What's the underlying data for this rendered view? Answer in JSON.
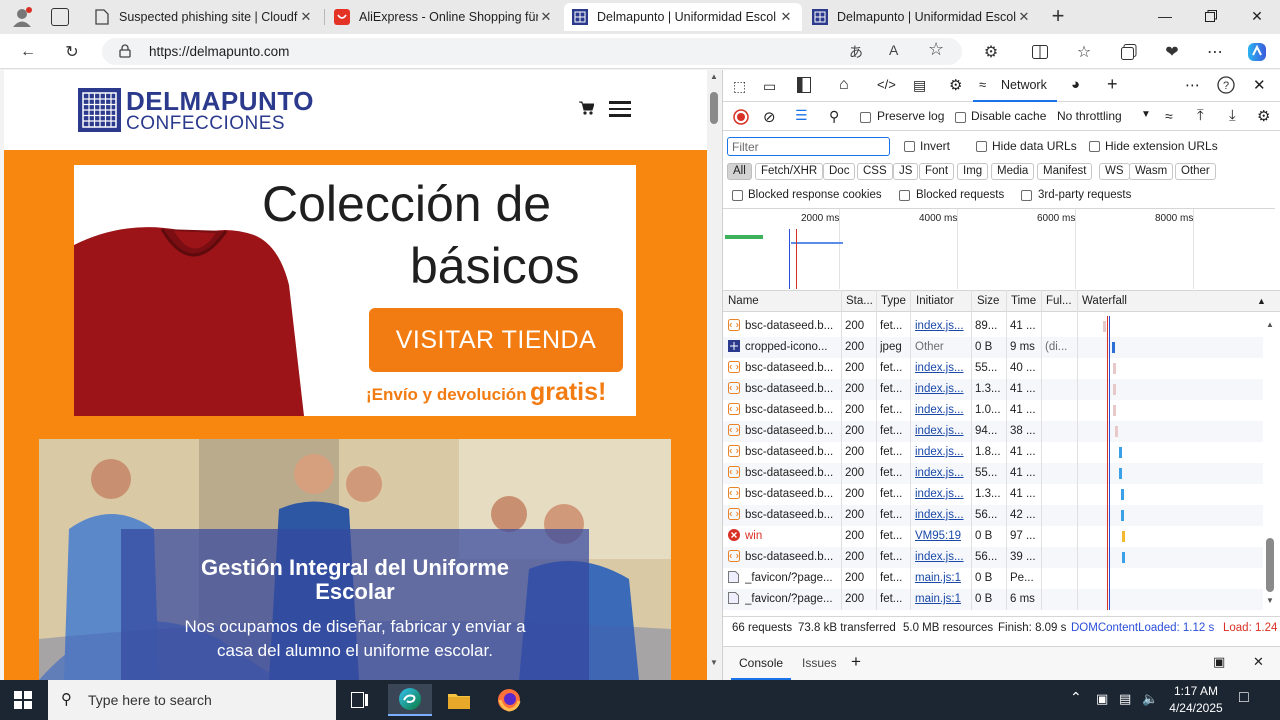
{
  "browser": {
    "tabs": [
      {
        "title": "Suspected phishing site | Cloudfl",
        "icon": "page-icon"
      },
      {
        "title": "AliExpress - Online Shopping für",
        "icon": "aliexpress-icon"
      },
      {
        "title": "Delmapunto | Uniformidad Escol",
        "icon": "site-icon",
        "active": true
      },
      {
        "title": "Delmapunto | Uniformidad Escol",
        "icon": "site-icon"
      }
    ],
    "new_tab_symbol": "+",
    "close_symbol": "✕",
    "url": "https://delmapunto.com"
  },
  "site": {
    "logo_title": "DELMAPUNTO",
    "logo_subtitle": "CONFECCIONES",
    "banner_line1": "Colección de",
    "banner_line2": "básicos",
    "banner_button": "VISITAR TIENDA",
    "banner_tagline_prefix": "¡Envío y devolución",
    "banner_tagline_emphasis": "gratis!",
    "hero_title_line1": "Gestión Integral del Uniforme",
    "hero_title_line2": "Escolar",
    "hero_text_line1": "Nos ocupamos de diseñar, fabricar y enviar a",
    "hero_text_line2": "casa del alumno el uniforme escolar.",
    "colors": {
      "orange": "#f7870f",
      "navy": "#2b3a8c",
      "sweater": "#9c1418"
    }
  },
  "devtools": {
    "active_panel": "Network",
    "preserve_log": "Preserve log",
    "disable_cache": "Disable cache",
    "throttling": "No throttling",
    "filter_placeholder": "Filter",
    "invert": "Invert",
    "hide_data_urls": "Hide data URLs",
    "hide_extension_urls": "Hide extension URLs",
    "type_filters": [
      "All",
      "Fetch/XHR",
      "Doc",
      "CSS",
      "JS",
      "Font",
      "Img",
      "Media",
      "Manifest",
      "WS",
      "Wasm",
      "Other"
    ],
    "blocked_response_cookies": "Blocked response cookies",
    "blocked_requests": "Blocked requests",
    "third_party": "3rd-party requests",
    "timeline_ticks": [
      "2000 ms",
      "4000 ms",
      "6000 ms",
      "8000 ms"
    ],
    "columns": [
      "Name",
      "Sta...",
      "Type",
      "Initiator",
      "Size",
      "Time",
      "Ful...",
      "Waterfall"
    ],
    "rows": [
      {
        "name": "bsc-dataseed.b...",
        "status": "200",
        "type": "fet...",
        "initiator": "index.js...",
        "size": "89...",
        "time": "41 ...",
        "full": "",
        "kind": "fetch",
        "wf": 0.12
      },
      {
        "name": "cropped-icono...",
        "status": "200",
        "type": "jpeg",
        "initiator": "Other",
        "size": "0 B",
        "time": "9 ms",
        "full": "(di...",
        "kind": "img",
        "wf": 0.17
      },
      {
        "name": "bsc-dataseed.b...",
        "status": "200",
        "type": "fet...",
        "initiator": "index.js...",
        "size": "55...",
        "time": "40 ...",
        "full": "",
        "kind": "fetch",
        "wf": 0.18
      },
      {
        "name": "bsc-dataseed.b...",
        "status": "200",
        "type": "fet...",
        "initiator": "index.js...",
        "size": "1.3...",
        "time": "41 ...",
        "full": "",
        "kind": "fetch",
        "wf": 0.18
      },
      {
        "name": "bsc-dataseed.b...",
        "status": "200",
        "type": "fet...",
        "initiator": "index.js...",
        "size": "1.0...",
        "time": "41 ...",
        "full": "",
        "kind": "fetch",
        "wf": 0.18
      },
      {
        "name": "bsc-dataseed.b...",
        "status": "200",
        "type": "fet...",
        "initiator": "index.js...",
        "size": "94...",
        "time": "38 ...",
        "full": "",
        "kind": "fetch",
        "wf": 0.19
      },
      {
        "name": "bsc-dataseed.b...",
        "status": "200",
        "type": "fet...",
        "initiator": "index.js...",
        "size": "1.8...",
        "time": "41 ...",
        "full": "",
        "kind": "fetch",
        "wf": 0.21
      },
      {
        "name": "bsc-dataseed.b...",
        "status": "200",
        "type": "fet...",
        "initiator": "index.js...",
        "size": "55...",
        "time": "41 ...",
        "full": "",
        "kind": "fetch",
        "wf": 0.21
      },
      {
        "name": "bsc-dataseed.b...",
        "status": "200",
        "type": "fet...",
        "initiator": "index.js...",
        "size": "1.3...",
        "time": "41 ...",
        "full": "",
        "kind": "fetch",
        "wf": 0.22
      },
      {
        "name": "bsc-dataseed.b...",
        "status": "200",
        "type": "fet...",
        "initiator": "index.js...",
        "size": "56...",
        "time": "42 ...",
        "full": "",
        "kind": "fetch",
        "wf": 0.22
      },
      {
        "name": "win",
        "status": "200",
        "type": "fet...",
        "initiator": "VM95:19",
        "size": "0 B",
        "time": "97 ...",
        "full": "",
        "kind": "error",
        "wf": 0.23
      },
      {
        "name": "bsc-dataseed.b...",
        "status": "200",
        "type": "fet...",
        "initiator": "index.js...",
        "size": "56...",
        "time": "39 ...",
        "full": "",
        "kind": "fetch",
        "wf": 0.23
      },
      {
        "name": "_favicon/?page...",
        "status": "200",
        "type": "fet...",
        "initiator": "main.js:1",
        "size": "0 B",
        "time": "Pe...",
        "full": "",
        "kind": "doc",
        "wf": 0.0
      },
      {
        "name": "_favicon/?page...",
        "status": "200",
        "type": "fet...",
        "initiator": "main.js:1",
        "size": "0 B",
        "time": "6 ms",
        "full": "",
        "kind": "doc",
        "wf": 0.0
      }
    ],
    "status_requests": "66 requests",
    "status_transferred": "73.8 kB transferred",
    "status_resources": "5.0 MB resources",
    "status_finish": "Finish: 8.09 s",
    "status_dcl": "DOMContentLoaded: 1.12 s",
    "status_load": "Load: 1.24",
    "drawer_tabs": [
      "Console",
      "Issues"
    ]
  },
  "taskbar": {
    "search_placeholder": "Type here to search",
    "time": "1:17 AM",
    "date": "4/24/2025"
  }
}
